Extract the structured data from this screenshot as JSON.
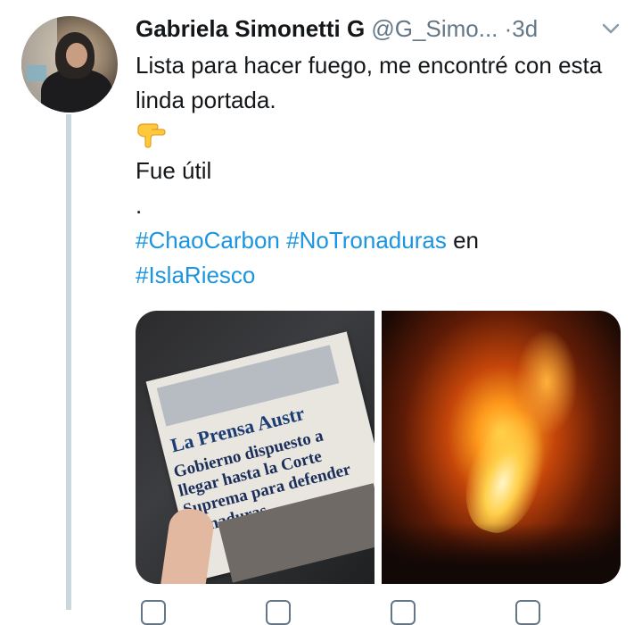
{
  "tweet": {
    "author_name": "Gabriela Simonetti G",
    "handle": "@G_Simo...",
    "separator": "·",
    "time": "3d",
    "text_line1": "Lista para hacer fuego, me encontré con esta linda portada.",
    "emoji": "👇",
    "text_line2": "Fue útil",
    "text_line3": ".",
    "hashtag1": "#ChaoCarbon",
    "hashtag2": "#NoTronaduras",
    "text_connector": "en",
    "hashtag3": "#IslaRiesco"
  },
  "media": {
    "photo_left": {
      "newspaper_name": "La Prensa Austr",
      "headline": "Gobierno dispuesto a llegar hasta la Corte Suprema para defender tronaduras"
    },
    "photo_right": {
      "subject": "fire"
    }
  },
  "colors": {
    "hashtag": "#1b95e0",
    "secondary_text": "#657786",
    "thread_line": "#ccd6dd"
  },
  "icons": [
    "chevron-down-icon",
    "reply-icon",
    "retweet-icon",
    "like-icon",
    "share-icon"
  ]
}
